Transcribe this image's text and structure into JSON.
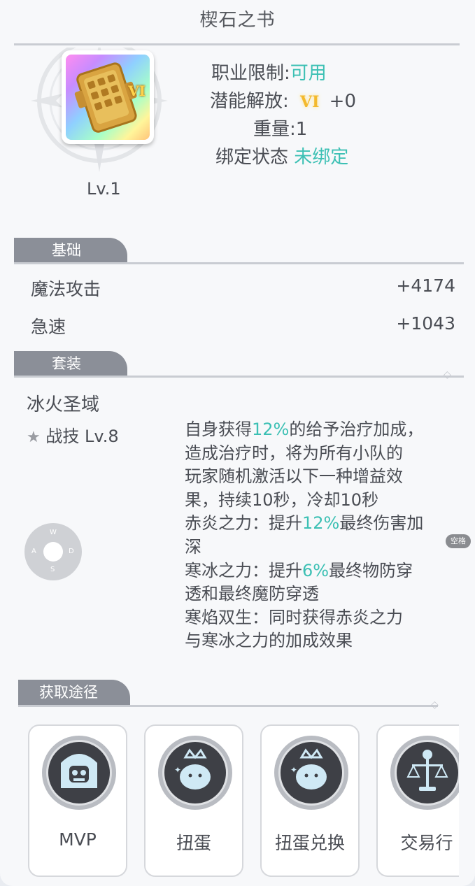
{
  "window": {
    "title": "楔石之书"
  },
  "item": {
    "level": "Lv.1",
    "tier_badge": "VI",
    "info": {
      "class_limit_label": "职业限制:",
      "class_limit_value": "可用",
      "potential_label": "潜能解放:",
      "potential_tier": "VI",
      "potential_value": "+0",
      "weight": "重量:1",
      "bind_label": "绑定状态",
      "bind_value": "未绑定"
    }
  },
  "sections": {
    "basic": {
      "tab_label": "基础",
      "stats": [
        {
          "label": "魔法攻击",
          "value": "+4174"
        },
        {
          "label": "急速",
          "value": "+1043"
        }
      ]
    },
    "set": {
      "tab_label": "套装",
      "name": "冰火圣域",
      "skill_label": "战技 Lv.8",
      "description": [
        {
          "pre": "自身获得",
          "hl": "12%",
          "post": "的给予治疗加成，"
        },
        {
          "pre": "造成治疗时，将为所有小队的",
          "hl": "",
          "post": ""
        },
        {
          "pre": "玩家随机激活以下一种增益效",
          "hl": "",
          "post": ""
        },
        {
          "pre": "果，持续10秒，冷却10秒",
          "hl": "",
          "post": ""
        },
        {
          "pre": "赤炎之力：提升",
          "hl": "12%",
          "post": "最终伤害加"
        },
        {
          "pre": "深",
          "hl": "",
          "post": ""
        },
        {
          "pre": "寒冰之力：提升",
          "hl": "6%",
          "post": "最终物防穿"
        },
        {
          "pre": "透和最终魔防穿透",
          "hl": "",
          "post": ""
        },
        {
          "pre": "寒焰双生：同时获得赤炎之力",
          "hl": "",
          "post": ""
        },
        {
          "pre": "与寒冰之力的加成效果",
          "hl": "",
          "post": ""
        }
      ]
    },
    "sources": {
      "tab_label": "获取途径",
      "items": [
        {
          "label": "MVP",
          "icon": "skull-mvp-icon"
        },
        {
          "label": "扭蛋",
          "icon": "crowned-blob-icon"
        },
        {
          "label": "扭蛋兑换",
          "icon": "crowned-blob-icon"
        },
        {
          "label": "交易行",
          "icon": "scales-icon"
        }
      ]
    }
  },
  "overlay": {
    "joystick": {
      "up": "W",
      "left": "A",
      "right": "D",
      "down": "S"
    },
    "space_key": "空格"
  },
  "colors": {
    "accent": "#3cc0b4",
    "tab_bg": "#8b8f98",
    "panel_bg": "#f7f8fa"
  }
}
